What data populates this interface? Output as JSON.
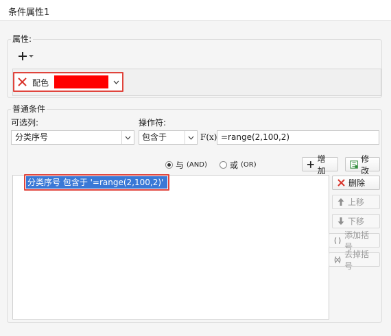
{
  "window": {
    "title": "条件属性1"
  },
  "properties": {
    "legend": "属性:",
    "color_item": {
      "label": "配色",
      "color": "#ff0000"
    }
  },
  "conditions": {
    "legend": "普通条件",
    "column_label": "可选列:",
    "operator_label": "操作符:",
    "column_value": "分类序号",
    "operator_value": "包含于",
    "formula_icon_text": "F(x)",
    "value": "=range(2,100,2)",
    "logic": {
      "and_label": "与",
      "and_small": "(AND)",
      "or_label": "或",
      "or_small": "(OR)",
      "selected": "and"
    },
    "add_button": "增加",
    "modify_button": "修改",
    "condition_list": [
      {
        "text": "分类序号 包含于 '=range(2,100,2)'",
        "selected": true
      }
    ],
    "side_buttons": {
      "delete": "删除",
      "move_up": "上移",
      "move_down": "下移",
      "add_bracket": "添加括号",
      "remove_bracket": "去掉括号"
    }
  },
  "colors": {
    "highlight_red": "#e0443c",
    "selection_blue": "#3a78d6",
    "accent_green": "#2e8b3a"
  }
}
